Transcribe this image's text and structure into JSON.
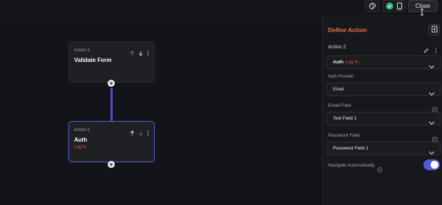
{
  "topbar": {
    "close_label": "Close"
  },
  "canvas": {
    "nodes": [
      {
        "label": "Action 1",
        "title": "Validate Form",
        "subtitle": ""
      },
      {
        "label": "Action 2",
        "title": "Auth",
        "subtitle": "Log In"
      }
    ]
  },
  "panel": {
    "title": "Define Action",
    "action_name": "Action 2",
    "action_select": {
      "main": "Auth",
      "sub": "Log In"
    },
    "auth_provider": {
      "label": "Auth Provider",
      "value": "Email"
    },
    "email_field": {
      "label": "Email Field",
      "value": "Text Field 1"
    },
    "password_field": {
      "label": "Password Field",
      "value": "Password Field 1"
    },
    "navigate": {
      "label": "Navigate Automatically",
      "enabled": true
    }
  },
  "colors": {
    "accent": "#5358e0",
    "title_orange": "#e9744a",
    "connector": "#4d50cf"
  }
}
